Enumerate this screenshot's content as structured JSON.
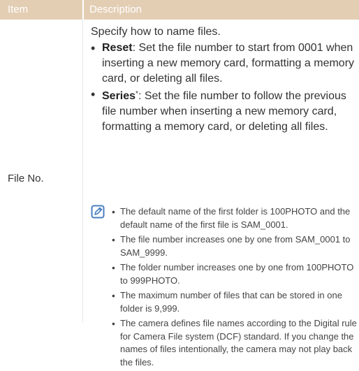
{
  "table": {
    "header": {
      "item": "Item",
      "description": "Description"
    },
    "row": {
      "item": "File No.",
      "intro": "Specify how to name files.",
      "options": [
        {
          "name": "Reset",
          "marker": "",
          "text": ": Set the file number to start from 0001 when inserting a new memory card, formatting a memory card, or deleting all files."
        },
        {
          "name": "Series",
          "marker": "*",
          "text": ": Set the file number to follow the previous file number when inserting a new memory card, formatting a memory card, or deleting all files."
        }
      ],
      "notes": [
        "The default name of the first folder is 100PHOTO and the default name of the first file is SAM_0001.",
        "The file number increases one by one from SAM_0001 to SAM_9999.",
        "The folder number increases one by one from 100PHOTO to 999PHOTO.",
        "The maximum number of files that can be stored in one folder is 9,999.",
        "The camera defines file names according to the Digital rule for Camera File system (DCF) standard. If you change the names of files intentionally, the camera may not play back the files."
      ]
    }
  },
  "colors": {
    "header_bg": "#E3CEB4",
    "note_icon": "#4A7FC0",
    "text": "#333333"
  },
  "icons": {
    "note": "note-pencil-icon"
  }
}
